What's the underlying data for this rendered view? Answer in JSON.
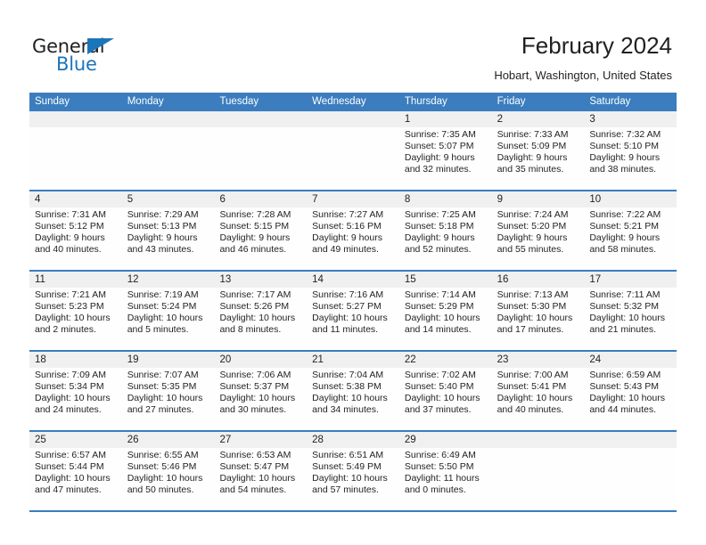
{
  "logo": {
    "word_one": "General",
    "word_two": "Blue",
    "triangle_icon": "triangle-icon",
    "brand_color": "#1b75bb"
  },
  "header": {
    "title": "February 2024",
    "subtitle": "Hobart, Washington, United States"
  },
  "calendar": {
    "header_color": "#3b7dbf",
    "date_band_color": "#f0f0f0",
    "weekdays": [
      "Sunday",
      "Monday",
      "Tuesday",
      "Wednesday",
      "Thursday",
      "Friday",
      "Saturday"
    ],
    "weeks": [
      [
        {
          "day": "",
          "lines": []
        },
        {
          "day": "",
          "lines": []
        },
        {
          "day": "",
          "lines": []
        },
        {
          "day": "",
          "lines": []
        },
        {
          "day": "1",
          "lines": [
            "Sunrise: 7:35 AM",
            "Sunset: 5:07 PM",
            "Daylight: 9 hours",
            "and 32 minutes."
          ]
        },
        {
          "day": "2",
          "lines": [
            "Sunrise: 7:33 AM",
            "Sunset: 5:09 PM",
            "Daylight: 9 hours",
            "and 35 minutes."
          ]
        },
        {
          "day": "3",
          "lines": [
            "Sunrise: 7:32 AM",
            "Sunset: 5:10 PM",
            "Daylight: 9 hours",
            "and 38 minutes."
          ]
        }
      ],
      [
        {
          "day": "4",
          "lines": [
            "Sunrise: 7:31 AM",
            "Sunset: 5:12 PM",
            "Daylight: 9 hours",
            "and 40 minutes."
          ]
        },
        {
          "day": "5",
          "lines": [
            "Sunrise: 7:29 AM",
            "Sunset: 5:13 PM",
            "Daylight: 9 hours",
            "and 43 minutes."
          ]
        },
        {
          "day": "6",
          "lines": [
            "Sunrise: 7:28 AM",
            "Sunset: 5:15 PM",
            "Daylight: 9 hours",
            "and 46 minutes."
          ]
        },
        {
          "day": "7",
          "lines": [
            "Sunrise: 7:27 AM",
            "Sunset: 5:16 PM",
            "Daylight: 9 hours",
            "and 49 minutes."
          ]
        },
        {
          "day": "8",
          "lines": [
            "Sunrise: 7:25 AM",
            "Sunset: 5:18 PM",
            "Daylight: 9 hours",
            "and 52 minutes."
          ]
        },
        {
          "day": "9",
          "lines": [
            "Sunrise: 7:24 AM",
            "Sunset: 5:20 PM",
            "Daylight: 9 hours",
            "and 55 minutes."
          ]
        },
        {
          "day": "10",
          "lines": [
            "Sunrise: 7:22 AM",
            "Sunset: 5:21 PM",
            "Daylight: 9 hours",
            "and 58 minutes."
          ]
        }
      ],
      [
        {
          "day": "11",
          "lines": [
            "Sunrise: 7:21 AM",
            "Sunset: 5:23 PM",
            "Daylight: 10 hours",
            "and 2 minutes."
          ]
        },
        {
          "day": "12",
          "lines": [
            "Sunrise: 7:19 AM",
            "Sunset: 5:24 PM",
            "Daylight: 10 hours",
            "and 5 minutes."
          ]
        },
        {
          "day": "13",
          "lines": [
            "Sunrise: 7:17 AM",
            "Sunset: 5:26 PM",
            "Daylight: 10 hours",
            "and 8 minutes."
          ]
        },
        {
          "day": "14",
          "lines": [
            "Sunrise: 7:16 AM",
            "Sunset: 5:27 PM",
            "Daylight: 10 hours",
            "and 11 minutes."
          ]
        },
        {
          "day": "15",
          "lines": [
            "Sunrise: 7:14 AM",
            "Sunset: 5:29 PM",
            "Daylight: 10 hours",
            "and 14 minutes."
          ]
        },
        {
          "day": "16",
          "lines": [
            "Sunrise: 7:13 AM",
            "Sunset: 5:30 PM",
            "Daylight: 10 hours",
            "and 17 minutes."
          ]
        },
        {
          "day": "17",
          "lines": [
            "Sunrise: 7:11 AM",
            "Sunset: 5:32 PM",
            "Daylight: 10 hours",
            "and 21 minutes."
          ]
        }
      ],
      [
        {
          "day": "18",
          "lines": [
            "Sunrise: 7:09 AM",
            "Sunset: 5:34 PM",
            "Daylight: 10 hours",
            "and 24 minutes."
          ]
        },
        {
          "day": "19",
          "lines": [
            "Sunrise: 7:07 AM",
            "Sunset: 5:35 PM",
            "Daylight: 10 hours",
            "and 27 minutes."
          ]
        },
        {
          "day": "20",
          "lines": [
            "Sunrise: 7:06 AM",
            "Sunset: 5:37 PM",
            "Daylight: 10 hours",
            "and 30 minutes."
          ]
        },
        {
          "day": "21",
          "lines": [
            "Sunrise: 7:04 AM",
            "Sunset: 5:38 PM",
            "Daylight: 10 hours",
            "and 34 minutes."
          ]
        },
        {
          "day": "22",
          "lines": [
            "Sunrise: 7:02 AM",
            "Sunset: 5:40 PM",
            "Daylight: 10 hours",
            "and 37 minutes."
          ]
        },
        {
          "day": "23",
          "lines": [
            "Sunrise: 7:00 AM",
            "Sunset: 5:41 PM",
            "Daylight: 10 hours",
            "and 40 minutes."
          ]
        },
        {
          "day": "24",
          "lines": [
            "Sunrise: 6:59 AM",
            "Sunset: 5:43 PM",
            "Daylight: 10 hours",
            "and 44 minutes."
          ]
        }
      ],
      [
        {
          "day": "25",
          "lines": [
            "Sunrise: 6:57 AM",
            "Sunset: 5:44 PM",
            "Daylight: 10 hours",
            "and 47 minutes."
          ]
        },
        {
          "day": "26",
          "lines": [
            "Sunrise: 6:55 AM",
            "Sunset: 5:46 PM",
            "Daylight: 10 hours",
            "and 50 minutes."
          ]
        },
        {
          "day": "27",
          "lines": [
            "Sunrise: 6:53 AM",
            "Sunset: 5:47 PM",
            "Daylight: 10 hours",
            "and 54 minutes."
          ]
        },
        {
          "day": "28",
          "lines": [
            "Sunrise: 6:51 AM",
            "Sunset: 5:49 PM",
            "Daylight: 10 hours",
            "and 57 minutes."
          ]
        },
        {
          "day": "29",
          "lines": [
            "Sunrise: 6:49 AM",
            "Sunset: 5:50 PM",
            "Daylight: 11 hours",
            "and 0 minutes."
          ]
        },
        {
          "day": "",
          "lines": []
        },
        {
          "day": "",
          "lines": []
        }
      ]
    ]
  }
}
